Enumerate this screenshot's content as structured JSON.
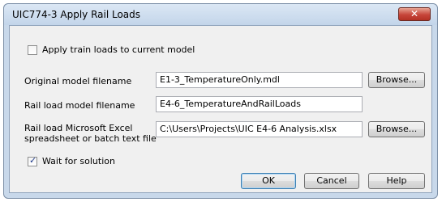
{
  "window": {
    "title": "UIC774-3 Apply Rail Loads",
    "close_glyph": "✕"
  },
  "apply_loads": {
    "label": "Apply train loads to current model",
    "checked": false
  },
  "original_model": {
    "label": "Original model filename",
    "value": "E1-3_TemperatureOnly.mdl",
    "browse_label": "Browse..."
  },
  "rail_load_model": {
    "label": "Rail load model filename",
    "value": "E4-6_TemperatureAndRailLoads"
  },
  "excel_file": {
    "label_line1": "Rail load Microsoft Excel",
    "label_line2": "spreadsheet or batch text file",
    "value": "C:\\Users\\Projects\\UIC E4-6 Analysis.xlsx",
    "browse_label": "Browse..."
  },
  "wait_for_solution": {
    "label": "Wait for solution",
    "checked": true
  },
  "buttons": {
    "ok": "OK",
    "cancel": "Cancel",
    "help": "Help"
  }
}
